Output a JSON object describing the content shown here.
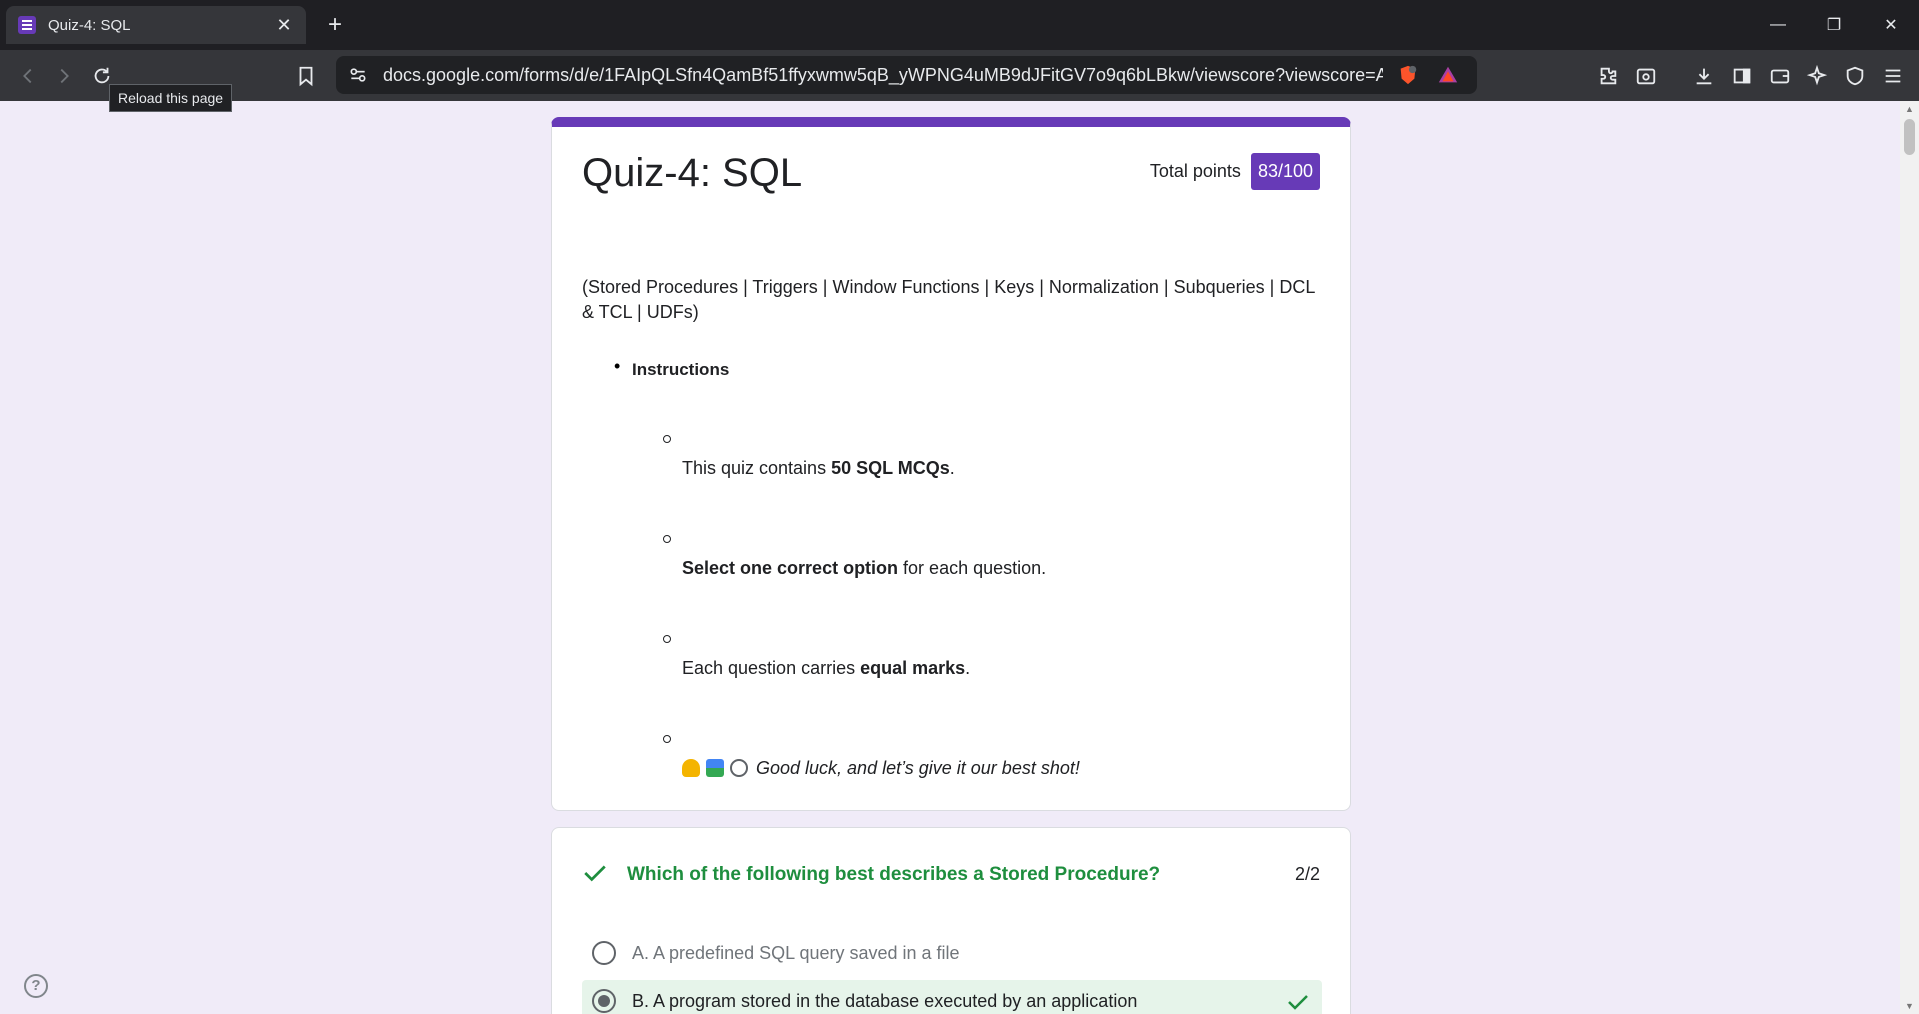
{
  "browser": {
    "tab_title": "Quiz-4: SQL",
    "url": "docs.google.com/forms/d/e/1FAIpQLSfn4QamBf51ffyxwmw5qB_yWPNG4uMB9dJFitGV7o9q6bLBkw/viewscore?viewscore=AE...",
    "tooltip": "Reload this page",
    "brave_badge_count": "1",
    "icons": [
      "back-icon",
      "forward-icon",
      "reload-icon",
      "bookmark-icon",
      "site-settings-icon",
      "brave-shield-icon",
      "brave-rewards-icon",
      "extensions-icon",
      "search-tabs-icon",
      "download-icon",
      "sidebar-icon",
      "wallet-icon",
      "leo-ai-icon",
      "vpn-icon",
      "menu-icon"
    ]
  },
  "form": {
    "title": "Quiz-4: SQL",
    "total_label": "Total points",
    "score": "83/100",
    "description": "(Stored Procedures | Triggers | Window Functions | Keys | Normalization | Subqueries | DCL & TCL | UDFs)",
    "instructions_heading": "Instructions",
    "instructions": [
      {
        "pre": "This quiz contains ",
        "bold": "50 SQL MCQs",
        "post": "."
      },
      {
        "pre": "",
        "bold": "Select one correct option",
        "post": " for each question."
      },
      {
        "pre": "Each question carries ",
        "bold": "equal marks",
        "post": "."
      }
    ],
    "closing": "Good luck, and let’s give it our best shot!",
    "accent_color": "#673ab7"
  },
  "question": {
    "title": "Which of the following best describes a Stored Procedure?",
    "points": "2/2",
    "options": [
      {
        "label": "A. A predefined SQL query saved in a file",
        "selected": false,
        "correct": false
      },
      {
        "label": "B. A program stored in the database executed by an application",
        "selected": true,
        "correct": true
      }
    ],
    "correct_color": "#1e8e3e"
  },
  "help_label": "?"
}
